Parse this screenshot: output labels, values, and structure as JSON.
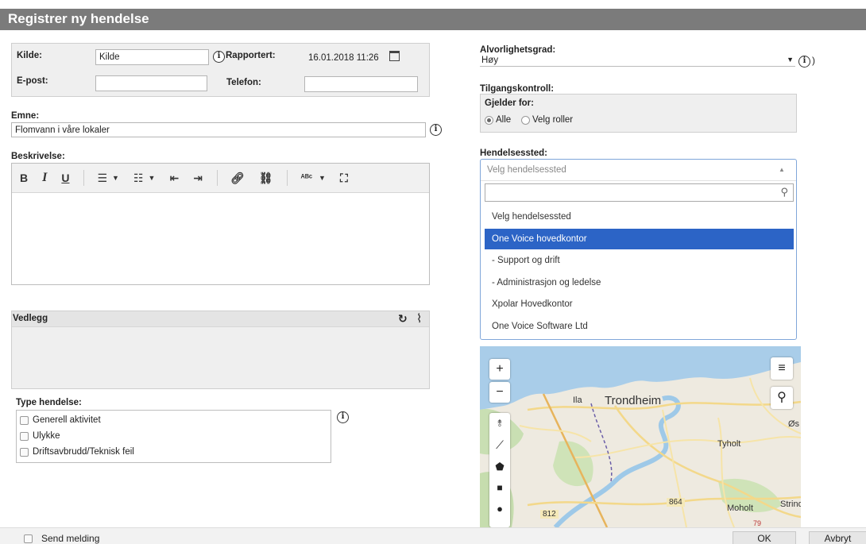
{
  "title": "Registrer ny hendelse",
  "header_fields": {
    "kilde_label": "Kilde:",
    "kilde_value": "Kilde",
    "rapportert_label": "Rapportert:",
    "rapportert_value": "16.01.2018 11:26",
    "epost_label": "E-post:",
    "epost_value": "",
    "telefon_label": "Telefon:",
    "telefon_value": ""
  },
  "emne": {
    "label": "Emne:",
    "value": "Flomvann i våre lokaler"
  },
  "beskrivelse": {
    "label": "Beskrivelse:",
    "value": ""
  },
  "vedlegg": {
    "label": "Vedlegg"
  },
  "type_hendelse": {
    "label": "Type hendelse:",
    "options": [
      "Generell aktivitet",
      "Ulykke",
      "Driftsavbrudd/Teknisk feil"
    ]
  },
  "alvorlighetsgrad": {
    "label": "Alvorlighetsgrad:",
    "value": "Høy",
    "trailing": ")"
  },
  "tilgangskontroll": {
    "label": "Tilgangskontroll:",
    "gjelder_label": "Gjelder for:",
    "options": [
      "Alle",
      "Velg roller"
    ],
    "selected": "Alle"
  },
  "hendelsessted": {
    "label": "Hendelsessted:",
    "placeholder": "Velg hendelsessted",
    "search_value": "",
    "options": [
      "Velg hendelsessted",
      "One Voice hovedkontor",
      "- Support og drift",
      "- Administrasjon og ledelse",
      "Xpolar Hovedkontor",
      "One Voice Software Ltd"
    ],
    "highlighted": "One Voice hovedkontor"
  },
  "map": {
    "labels": [
      "Ila",
      "Trondheim",
      "Tyholt",
      "Øs",
      "864",
      "812",
      "Moholt",
      "Strind",
      "79"
    ],
    "controls": [
      "+",
      "−"
    ]
  },
  "footer": {
    "send_melding": "Send melding",
    "ok": "OK",
    "avbryt": "Avbryt"
  },
  "colors": {
    "title_bar": "#7b7b7b",
    "selection": "#2c64c6",
    "panel": "#efefef"
  }
}
